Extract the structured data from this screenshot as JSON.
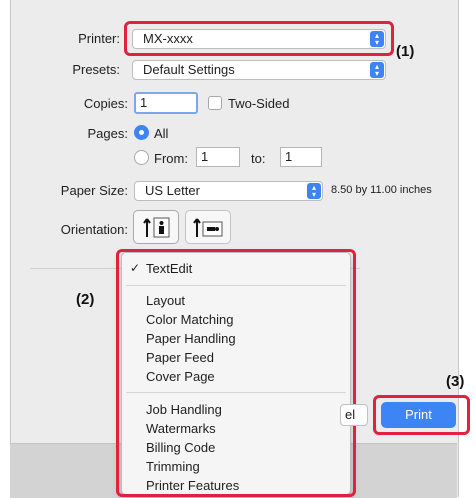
{
  "printer": {
    "label": "Printer:",
    "value": "MX-xxxx"
  },
  "presets": {
    "label": "Presets:",
    "value": "Default Settings"
  },
  "copies": {
    "label": "Copies:",
    "value": "1",
    "two_sided_label": "Two-Sided"
  },
  "pages": {
    "label": "Pages:",
    "all_label": "All",
    "from_label": "From:",
    "from_value": "1",
    "to_label": "to:",
    "to_value": "1"
  },
  "paper_size": {
    "label": "Paper Size:",
    "value": "US Letter",
    "dimensions": "8.50 by 11.00 inches"
  },
  "orientation": {
    "label": "Orientation:"
  },
  "menu": {
    "checked": "TextEdit",
    "group1": [
      "Layout",
      "Color Matching",
      "Paper Handling",
      "Paper Feed",
      "Cover Page"
    ],
    "group2": [
      "Job Handling",
      "Watermarks",
      "Billing Code",
      "Trimming",
      "Printer Features"
    ]
  },
  "cancel_partial": "el",
  "print_label": "Print",
  "callouts": {
    "c1": "(1)",
    "c2": "(2)",
    "c3": "(3)"
  },
  "colors": {
    "accent": "#3d84f5",
    "highlight": "#e2203f"
  }
}
